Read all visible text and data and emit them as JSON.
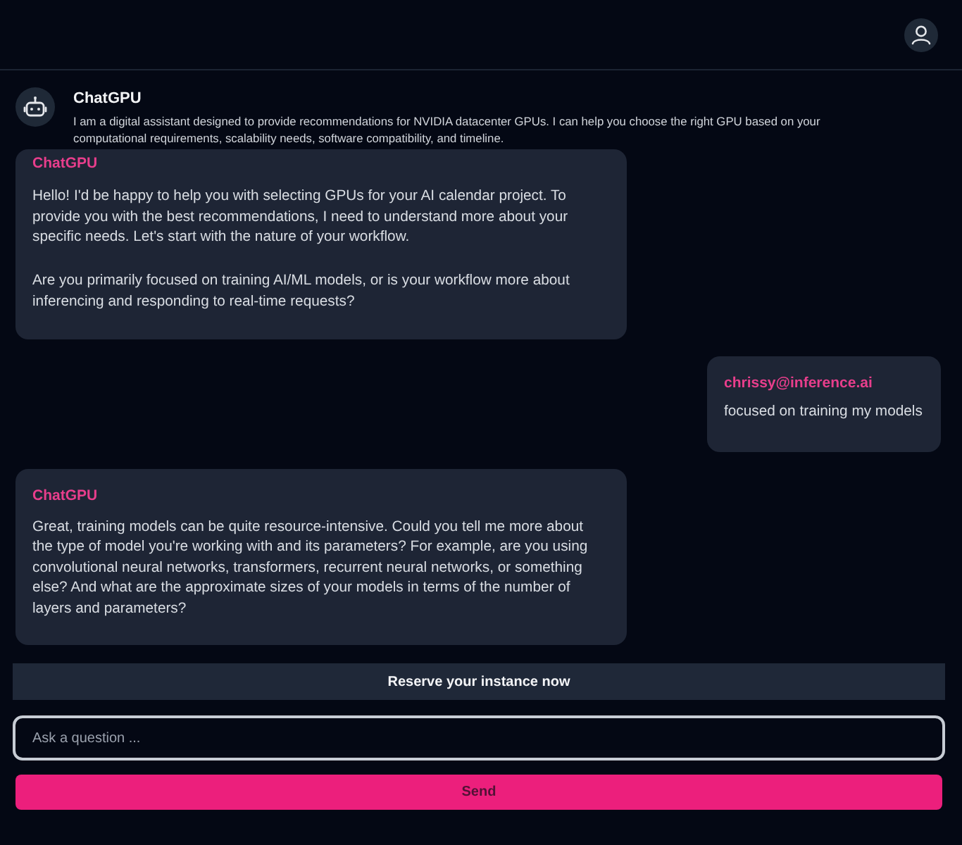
{
  "assistant": {
    "name": "ChatGPU",
    "description": "I am a digital assistant designed to provide recommendations for NVIDIA datacenter GPUs. I can help you choose the right GPU based on your computational requirements, scalability needs, software compatibility, and timeline."
  },
  "messages": [
    {
      "kind": "assistant",
      "sender": "ChatGPU",
      "paragraphs": [
        "Hello! I'd be happy to help you with selecting GPUs for your AI calendar project. To provide you with the best recommendations, I need to understand more about your specific needs. Let's start with the nature of your workflow.",
        "Are you primarily focused on training AI/ML models, or is your workflow more about inferencing and responding to real-time requests?"
      ]
    },
    {
      "kind": "user",
      "sender": "chrissy@inference.ai",
      "paragraphs": [
        "focused on training my models"
      ]
    },
    {
      "kind": "assistant",
      "sender": "ChatGPU",
      "paragraphs": [
        "Great, training models can be quite resource-intensive. Could you tell me more about the type of model you're working with and its parameters? For example, are you using convolutional neural networks, transformers, recurrent neural networks, or something else? And what are the approximate sizes of your models in terms of the number of layers and parameters?"
      ]
    }
  ],
  "reserve_banner": {
    "label": "Reserve your instance now"
  },
  "composer": {
    "placeholder": "Ask a question ...",
    "send_label": "Send"
  }
}
